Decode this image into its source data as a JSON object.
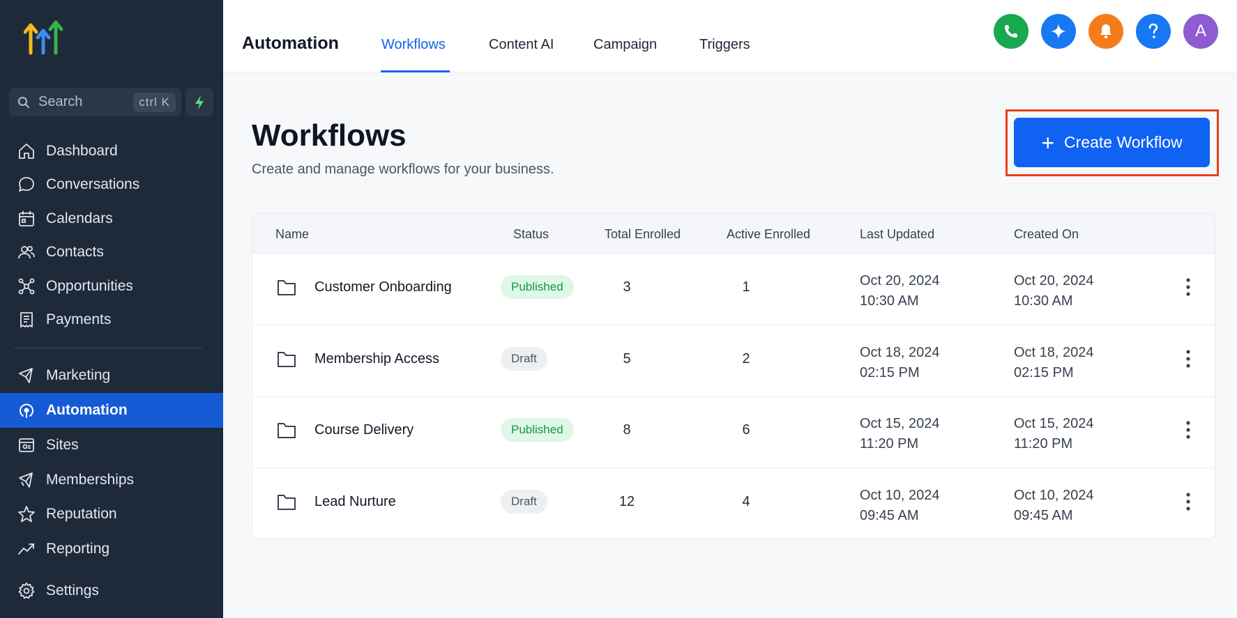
{
  "sidebar": {
    "search": {
      "placeholder": "Search",
      "shortcut": "ctrl K"
    },
    "items": [
      {
        "label": "Dashboard",
        "icon": "home-icon"
      },
      {
        "label": "Conversations",
        "icon": "chat-bubble-icon"
      },
      {
        "label": "Calendars",
        "icon": "calendar-icon"
      },
      {
        "label": "Contacts",
        "icon": "contacts-icon"
      },
      {
        "label": "Opportunities",
        "icon": "opportunities-icon"
      },
      {
        "label": "Payments",
        "icon": "receipt-icon"
      },
      {
        "label": "Marketing",
        "icon": "megaphone-icon"
      },
      {
        "label": "Automation",
        "icon": "automation-icon",
        "active": true
      },
      {
        "label": "Sites",
        "icon": "sites-icon"
      },
      {
        "label": "Memberships",
        "icon": "memberships-icon"
      },
      {
        "label": "Reputation",
        "icon": "star-icon"
      },
      {
        "label": "Reporting",
        "icon": "trend-icon"
      },
      {
        "label": "Settings",
        "icon": "gear-icon"
      }
    ]
  },
  "header": {
    "title": "Automation",
    "tabs": [
      {
        "label": "Workflows",
        "active": true
      },
      {
        "label": "Content AI"
      },
      {
        "label": "Campaign"
      },
      {
        "label": "Triggers"
      }
    ],
    "avatar_initial": "A",
    "actions": [
      {
        "icon": "phone-icon",
        "color": "#18a84e"
      },
      {
        "icon": "sparkle-icon",
        "color": "#1877f2"
      },
      {
        "icon": "bell-icon",
        "color": "#f57c1a"
      },
      {
        "icon": "help-icon",
        "color": "#1877f2"
      },
      {
        "icon": "avatar",
        "color": "#8e5bd0"
      }
    ]
  },
  "main": {
    "title": "Workflows",
    "subtitle": "Create and manage workflows for your business.",
    "create_button": "Create Workflow",
    "accent_color": "#0f62f2",
    "highlight_color": "#e8401c"
  },
  "table": {
    "columns": [
      "Name",
      "Status",
      "Total Enrolled",
      "Active Enrolled",
      "Last Updated",
      "Created On"
    ],
    "rows": [
      {
        "name": "Customer Onboarding",
        "status": "Published",
        "total": "3",
        "active": "1",
        "updated_date": "Oct 20, 2024",
        "updated_time": "10:30 AM",
        "created_date": "Oct 20, 2024",
        "created_time": "10:30 AM"
      },
      {
        "name": "Membership Access",
        "status": "Draft",
        "total": "5",
        "active": "2",
        "updated_date": "Oct 18, 2024",
        "updated_time": "02:15 PM",
        "created_date": "Oct 18, 2024",
        "created_time": "02:15 PM"
      },
      {
        "name": "Course Delivery",
        "status": "Published",
        "total": "8",
        "active": "6",
        "updated_date": "Oct 15, 2024",
        "updated_time": "11:20 PM",
        "created_date": "Oct 15, 2024",
        "created_time": "11:20 PM"
      },
      {
        "name": "Lead Nurture",
        "status": "Draft",
        "total": "12",
        "active": "4",
        "updated_date": "Oct 10, 2024",
        "updated_time": "09:45 AM",
        "created_date": "Oct 10, 2024",
        "created_time": "09:45 AM"
      }
    ]
  }
}
